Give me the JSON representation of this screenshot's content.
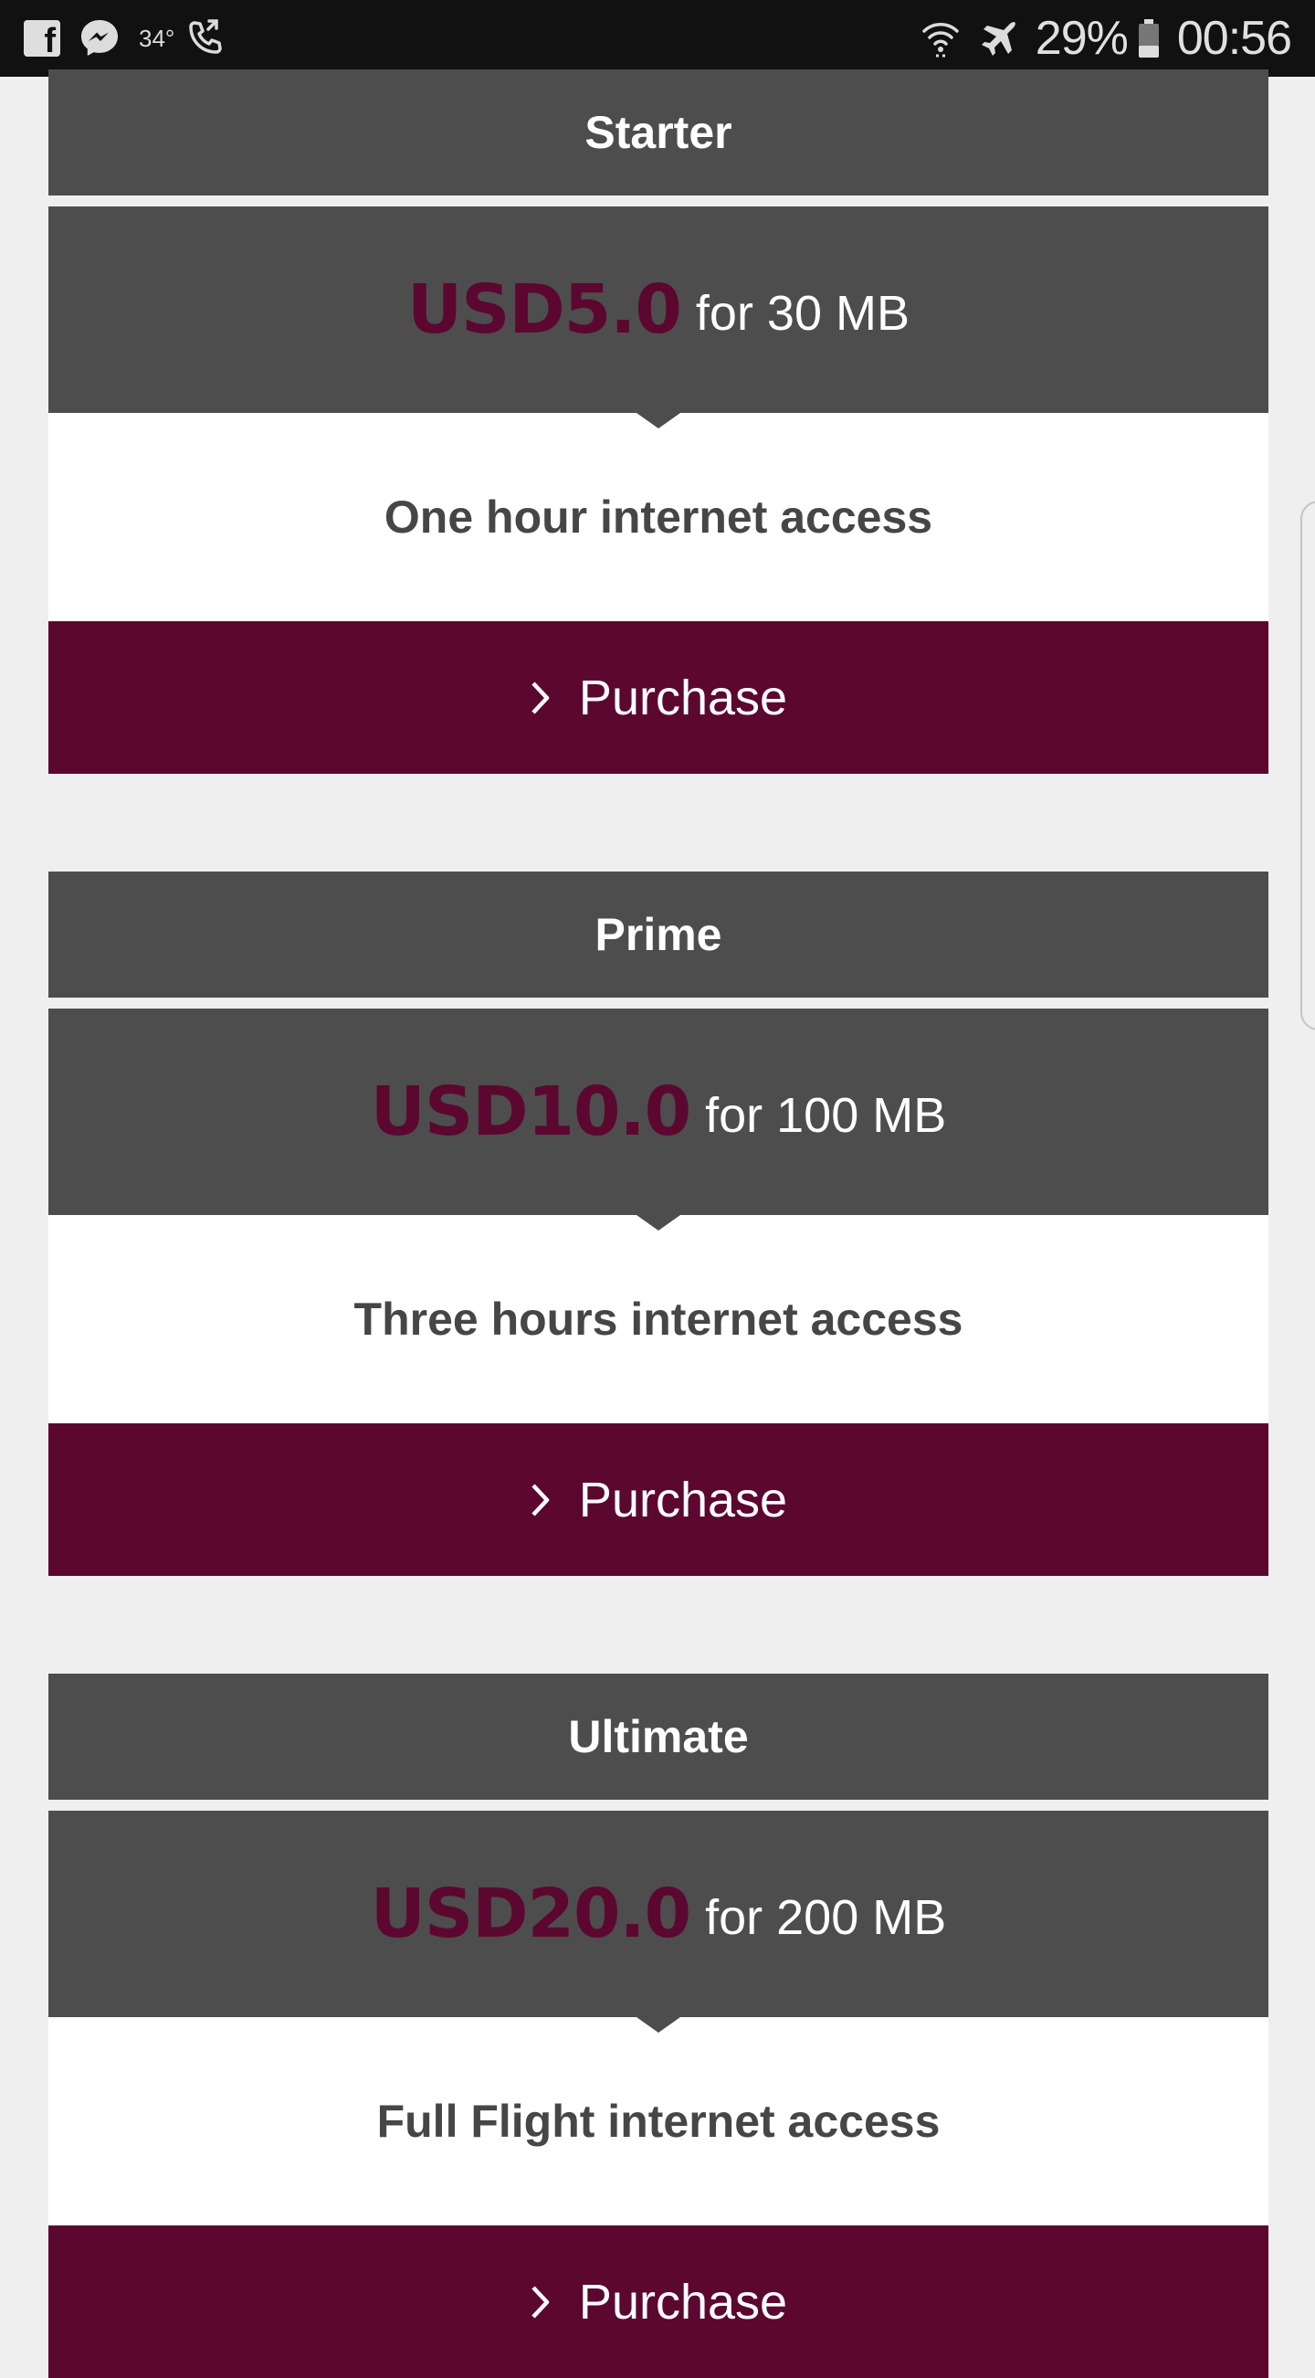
{
  "status_bar": {
    "temperature": "34°",
    "battery_percent": "29%",
    "time": "00:56",
    "icons": [
      "facebook-icon",
      "messenger-icon",
      "wifi-calling-icon",
      "wifi-icon",
      "airplane-mode-icon",
      "battery-icon"
    ]
  },
  "colors": {
    "accent": "#5b0730",
    "card_header": "#4d4d4d",
    "background": "#efefef"
  },
  "plans": [
    {
      "name": "Starter",
      "price": "USD5.0",
      "price_detail": "for 30 MB",
      "description": "One hour internet access",
      "button_label": "Purchase"
    },
    {
      "name": "Prime",
      "price": "USD10.0",
      "price_detail": "for 100 MB",
      "description": "Three hours internet access",
      "button_label": "Purchase"
    },
    {
      "name": "Ultimate",
      "price": "USD20.0",
      "price_detail": "for 200 MB",
      "description": "Full Flight internet access",
      "button_label": "Purchase"
    }
  ]
}
